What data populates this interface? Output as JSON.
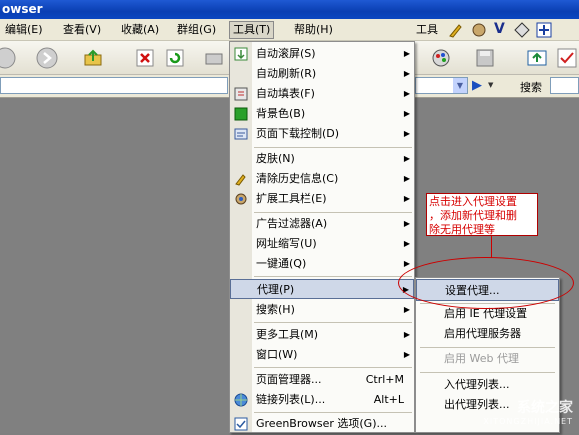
{
  "title": "owser",
  "menubar": {
    "items": [
      "编辑(E)",
      "查看(V)",
      "收藏(A)",
      "群组(G)",
      "工具(T)",
      "帮助(H)"
    ],
    "tools_label": "工具"
  },
  "address": {
    "search_label": "搜索"
  },
  "tools_menu": {
    "items": [
      {
        "label": "自动滚屏(S)",
        "submenu": true
      },
      {
        "label": "自动刷新(R)",
        "submenu": true
      },
      {
        "label": "自动填表(F)",
        "submenu": true
      },
      {
        "label": "背景色(B)",
        "submenu": true
      },
      {
        "label": "页面下载控制(D)",
        "submenu": true
      },
      {
        "label": "皮肤(N)",
        "submenu": true
      },
      {
        "label": "清除历史信息(C)",
        "submenu": true
      },
      {
        "label": "扩展工具栏(E)",
        "submenu": true
      },
      {
        "label": "广告过滤器(A)",
        "submenu": true
      },
      {
        "label": "网址缩写(U)",
        "submenu": true
      },
      {
        "label": "一键通(Q)",
        "submenu": true
      },
      {
        "label": "代理(P)",
        "submenu": true
      },
      {
        "label": "搜索(H)",
        "submenu": true
      },
      {
        "label": "更多工具(M)",
        "submenu": true
      },
      {
        "label": "窗口(W)",
        "submenu": true
      },
      {
        "label": "页面管理器...",
        "shortcut": "Ctrl+M"
      },
      {
        "label": "链接列表(L)...",
        "shortcut": "Alt+L"
      },
      {
        "label": "GreenBrowser 选项(G)..."
      }
    ]
  },
  "proxy_submenu": {
    "items": [
      "设置代理...",
      "启用 IE 代理设置",
      "启用代理服务器",
      "启用 Web 代理",
      "入代理列表...",
      "出代理列表..."
    ]
  },
  "annotation": {
    "line1": "点击进入代理设置",
    "line2": "，添加新代理和删",
    "line3": "除无用代理等"
  },
  "watermark": {
    "brand": "系统之家",
    "site": "XITONGZHIJIA.NET"
  }
}
